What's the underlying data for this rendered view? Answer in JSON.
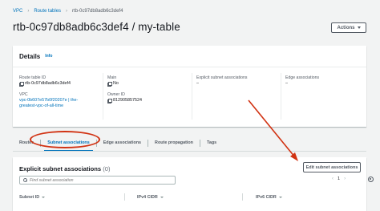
{
  "breadcrumb": {
    "items": [
      "VPC",
      "Route tables",
      "rtb-0c97db8adb6c3def4"
    ],
    "separator": "›"
  },
  "page": {
    "title": "rtb-0c97db8adb6c3def4 / my-table"
  },
  "actions": {
    "label": "Actions"
  },
  "details": {
    "title": "Details",
    "info": "Info",
    "route_table_id_label": "Route table ID",
    "route_table_id": "rtb-0c97db8adb6c3def4",
    "vpc_label": "VPC",
    "vpc_value_line1": "vpc-0b607e57b0f20207e | the-",
    "vpc_value_line2": "greatest-vpc-of-all-time",
    "main_label": "Main",
    "main_value": "No",
    "owner_id_label": "Owner ID",
    "owner_id": "812905857524",
    "explicit_label": "Explicit subnet associations",
    "explicit_value": "–",
    "edge_label": "Edge associations",
    "edge_value": "–"
  },
  "tabs": [
    {
      "label": "Routes",
      "active": false
    },
    {
      "label": "Subnet associations",
      "active": true
    },
    {
      "label": "Edge associations",
      "active": false
    },
    {
      "label": "Route propagation",
      "active": false
    },
    {
      "label": "Tags",
      "active": false
    }
  ],
  "associations": {
    "title": "Explicit subnet associations",
    "count": "(0)",
    "edit_button": "Edit subnet associations",
    "search_placeholder": "Find subnet association",
    "page_number": "1",
    "columns": [
      "Subnet ID",
      "IPv4 CIDR",
      "IPv6 CIDR"
    ]
  },
  "colors": {
    "link": "#0073bb",
    "annotation": "#d13212"
  }
}
